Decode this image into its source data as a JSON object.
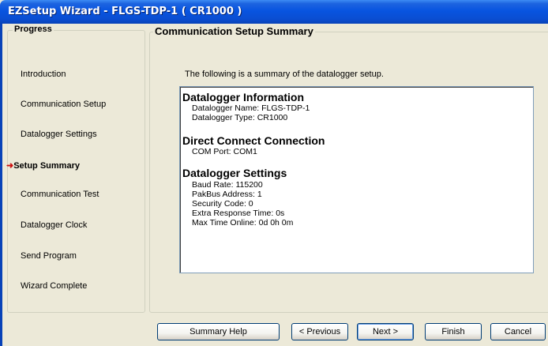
{
  "window": {
    "title": "EZSetup Wizard - FLGS-TDP-1 ( CR1000 )"
  },
  "progress": {
    "label": "Progress",
    "arrow": "➜",
    "steps": [
      {
        "label": "Introduction"
      },
      {
        "label": "Communication Setup"
      },
      {
        "label": "Datalogger Settings"
      },
      {
        "label": "Setup Summary"
      },
      {
        "label": "Communication Test"
      },
      {
        "label": "Datalogger Clock"
      },
      {
        "label": "Send Program"
      },
      {
        "label": "Wizard Complete"
      }
    ]
  },
  "main": {
    "heading": "Communication Setup Summary",
    "intro": "The following is a summary of the datalogger setup.",
    "summary": {
      "section1": {
        "title": "Datalogger Information",
        "lines": [
          "Datalogger Name: FLGS-TDP-1",
          "Datalogger Type: CR1000"
        ]
      },
      "section2": {
        "title": "Direct Connect Connection",
        "lines": [
          "COM Port: COM1"
        ]
      },
      "section3": {
        "title": "Datalogger Settings",
        "lines": [
          "Baud Rate: 115200",
          "PakBus Address: 1",
          "Security Code: 0",
          "Extra Response Time: 0s",
          "Max Time Online: 0d 0h 0m"
        ]
      }
    }
  },
  "buttons": {
    "summary_help": "Summary Help",
    "previous": "< Previous",
    "next": "Next >",
    "finish": "Finish",
    "cancel": "Cancel"
  },
  "colors": {
    "titlebar": "#0a4ed2",
    "window_bg": "#ece9d8",
    "active_arrow": "#cc1111"
  }
}
